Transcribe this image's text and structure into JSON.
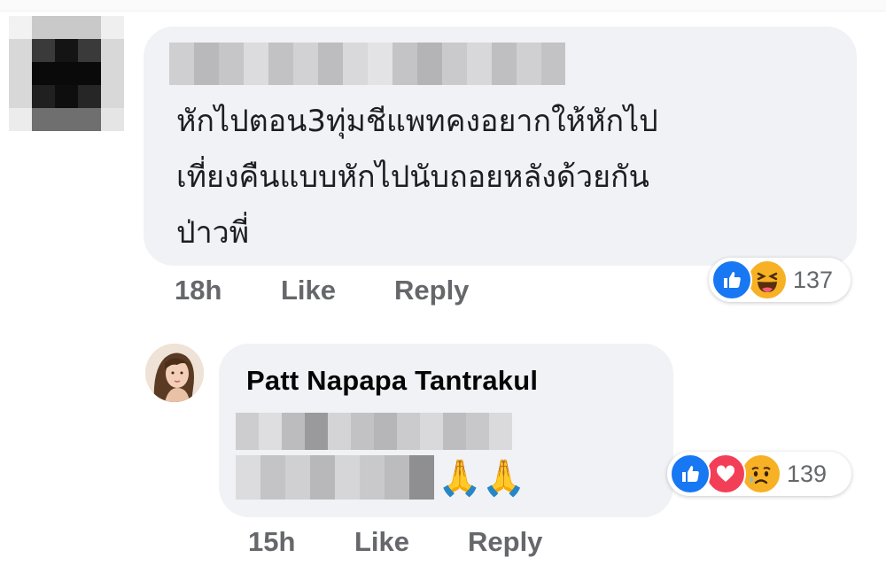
{
  "comment1": {
    "text_lines": [
      "หักไปตอน3ทุ่มชีแพทคงอยากให้หักไป",
      "เที่ยงคืนแบบหักไปนับถอยหลังด้วยกัน",
      "ป่าวพี่"
    ],
    "time": "18h",
    "like_label": "Like",
    "reply_label": "Reply",
    "reactions": [
      "like-icon",
      "haha-icon"
    ],
    "reaction_count": "137"
  },
  "comment2": {
    "author": "Patt Napapa Tantrakul",
    "emoji": "🙏🙏",
    "time": "15h",
    "like_label": "Like",
    "reply_label": "Reply",
    "reactions": [
      "like-icon",
      "love-icon",
      "sad-icon"
    ],
    "reaction_count": "139"
  },
  "colors": {
    "bubble": "#f0f2f5",
    "action_text": "#65676b",
    "like_blue": "#1877f2",
    "love_red": "#f33e58",
    "haha_yellow": "#f7b125"
  }
}
